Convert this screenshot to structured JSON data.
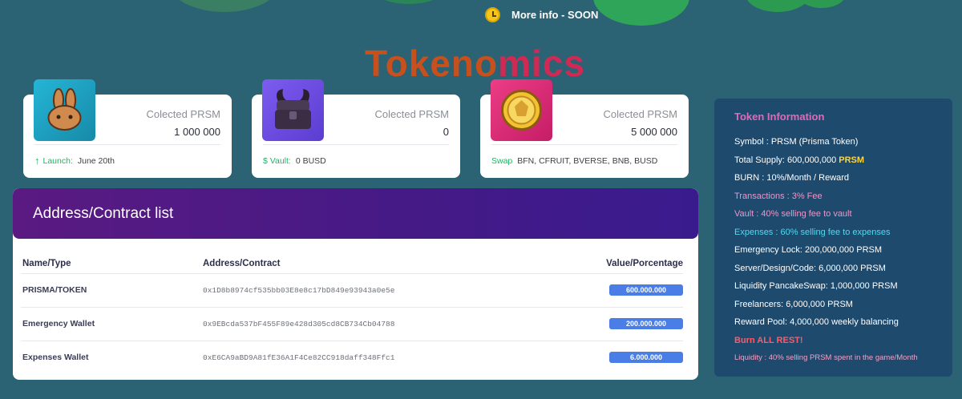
{
  "banner": {
    "more_info": "More info - SOON",
    "icon": "clock-icon"
  },
  "title": {
    "part1": "Tokeno",
    "part2": "mics"
  },
  "stat_cards": [
    {
      "icon": "pancakeswap-bunny-icon",
      "label": "Colected PRSM",
      "value": "1 000 000",
      "foot_lead": "Launch:",
      "foot_text": "June 20th"
    },
    {
      "icon": "treasure-chest-icon",
      "label": "Colected PRSM",
      "value": "0",
      "foot_lead": "$ Vault:",
      "foot_text": "0 BUSD"
    },
    {
      "icon": "gold-coin-icon",
      "label": "Colected PRSM",
      "value": "5 000 000",
      "foot_lead": "Swap",
      "foot_text": "BFN, CFRUIT, BVERSE, BNB, BUSD"
    }
  ],
  "contracts": {
    "title": "Address/Contract list",
    "columns": [
      "Name/Type",
      "Address/Contract",
      "Value/Porcentage"
    ],
    "rows": [
      {
        "name": "PRISMA/TOKEN",
        "address": "0x1D8b8974cf535bb03E8e8c17bD849e93943a0e5e",
        "value": "600.000.000"
      },
      {
        "name": "Emergency Wallet",
        "address": "0x9EBcda537bF455F89e428d305cd8CB734Cb04788",
        "value": "200.000.000"
      },
      {
        "name": "Expenses Wallet",
        "address": "0xE6CA9aBD9A81fE36A1F4Ce82CC918daff348Ffc1",
        "value": "6.000.000"
      }
    ]
  },
  "token_info": {
    "title": "Token Information",
    "symbol": "Symbol : PRSM (Prisma Token)",
    "supply_prefix": "Total Supply: 600,000,000",
    "supply_highlight": "PRSM",
    "burn": "BURN : 10%/Month / Reward",
    "transactions": "Transactions : 3% Fee",
    "vault": "Vault : 40% selling fee to vault",
    "expenses": "Expenses : 60% selling fee to expenses",
    "emergency": "Emergency Lock: 200,000,000 PRSM",
    "server": "Server/Design/Code: 6,000,000 PRSM",
    "liquidity_pcs": "Liquidity PancakeSwap: 1,000,000 PRSM",
    "freelancers": "Freelancers: 6,000,000 PRSM",
    "reward_pool": "Reward Pool: 4,000,000 weekly balancing",
    "burn_rest": "Burn ALL REST!",
    "liquidity_note": "Liquidity : 40% selling PRSM spent in the game/Month"
  },
  "colors": {
    "background": "#2b6274",
    "accent_green": "#1db764",
    "title_orange": "#c8501d",
    "title_pink": "#d02a54",
    "pill_blue": "#4a7ee6",
    "header_purple": "#5a1a82",
    "panel_navy": "#1e4a6e"
  }
}
